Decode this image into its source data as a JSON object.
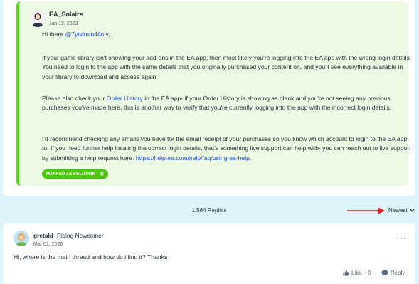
{
  "solution_post": {
    "author": "EA_Solaire",
    "date": "Jan 19, 2023",
    "greeting_prefix": "Hi there ",
    "greeting_mention": "@7ytvlmm44oiv",
    "greeting_suffix": ",",
    "para1": "If your game library isn't showing your add-ons in the EA app, then most likely you're logging into the EA app with the wrong login details. You need to login to the app with the same details that you originally purchased your content on, and you'll see everything available in your library to download and access again.",
    "para2_prefix": "Please also check your ",
    "para2_link": "Order History",
    "para2_suffix": " in the EA app- if your Order History is showing as blank and you're not seeing any previous purchases you've made here, this is another way to verify that you're currently logging into the app with the incorrect login details.",
    "para3_prefix": "I'd recommend checking any emails you have for the email receipt of your purchases so you know which account to login to the EA app to. If you need further help locating the correct login details, that's something live support can help with- you can reach out to live support by submitting a help request here: ",
    "para3_link": "https://help.ea.com/help/faq/using-ea-help",
    "para3_suffix": ".",
    "badge": "MARKED AS SOLUTION",
    "accent_color": "#5fd31e"
  },
  "replies_bar": {
    "count": "1,564 Replies",
    "sort": "Newest"
  },
  "reply": {
    "author": "gretald",
    "rank": "Rising Newcomer",
    "date": "Mar 01, 2026",
    "body": "Hi, where is the main thread and how do i find it? Thanks",
    "like_label": "Like",
    "like_sep": " - ",
    "like_count": "0",
    "reply_label": "Reply"
  }
}
